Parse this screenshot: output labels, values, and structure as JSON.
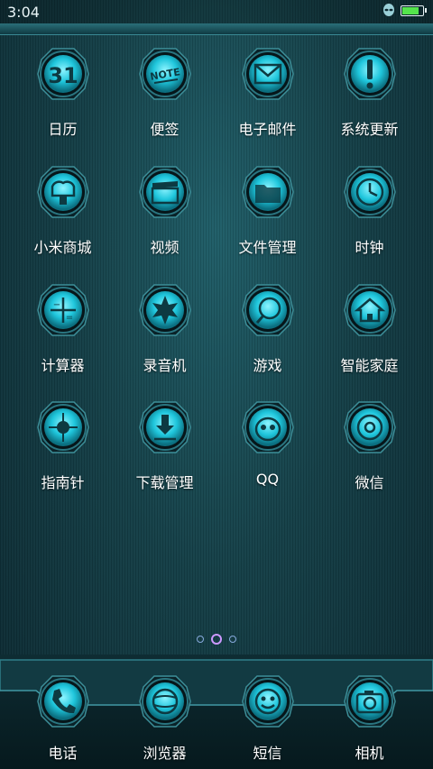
{
  "status_bar": {
    "time": "3:04",
    "battery_level": 0.9,
    "battery_color": "#54e54c"
  },
  "colors": {
    "accent": "#1fc6dc",
    "ring_dark": "#0a2228",
    "ring_light": "#3d8f99"
  },
  "apps": [
    {
      "label": "日历",
      "icon": "calendar-icon",
      "glyph": "31"
    },
    {
      "label": "便签",
      "icon": "note-icon",
      "glyph": "NOTE"
    },
    {
      "label": "电子邮件",
      "icon": "mail-icon",
      "glyph": ""
    },
    {
      "label": "系统更新",
      "icon": "exclamation-icon",
      "glyph": "!"
    },
    {
      "label": "小米商城",
      "icon": "store-icon",
      "glyph": ""
    },
    {
      "label": "视频",
      "icon": "clapperboard-icon",
      "glyph": ""
    },
    {
      "label": "文件管理",
      "icon": "folder-icon",
      "glyph": ""
    },
    {
      "label": "时钟",
      "icon": "clock-icon",
      "glyph": ""
    },
    {
      "label": "计算器",
      "icon": "calculator-icon",
      "glyph": ""
    },
    {
      "label": "录音机",
      "icon": "recorder-icon",
      "glyph": ""
    },
    {
      "label": "游戏",
      "icon": "game-ball-icon",
      "glyph": ""
    },
    {
      "label": "智能家庭",
      "icon": "home-icon",
      "glyph": ""
    },
    {
      "label": "指南针",
      "icon": "compass-icon",
      "glyph": ""
    },
    {
      "label": "下载管理",
      "icon": "download-icon",
      "glyph": ""
    },
    {
      "label": "QQ",
      "icon": "qq-penguin-icon",
      "glyph": ""
    },
    {
      "label": "微信",
      "icon": "wechat-icon",
      "glyph": ""
    }
  ],
  "dock": [
    {
      "label": "电话",
      "icon": "phone-icon"
    },
    {
      "label": "浏览器",
      "icon": "browser-globe-icon"
    },
    {
      "label": "短信",
      "icon": "messaging-icon"
    },
    {
      "label": "相机",
      "icon": "camera-icon"
    }
  ],
  "pager": {
    "pages": 3,
    "current": 1
  }
}
